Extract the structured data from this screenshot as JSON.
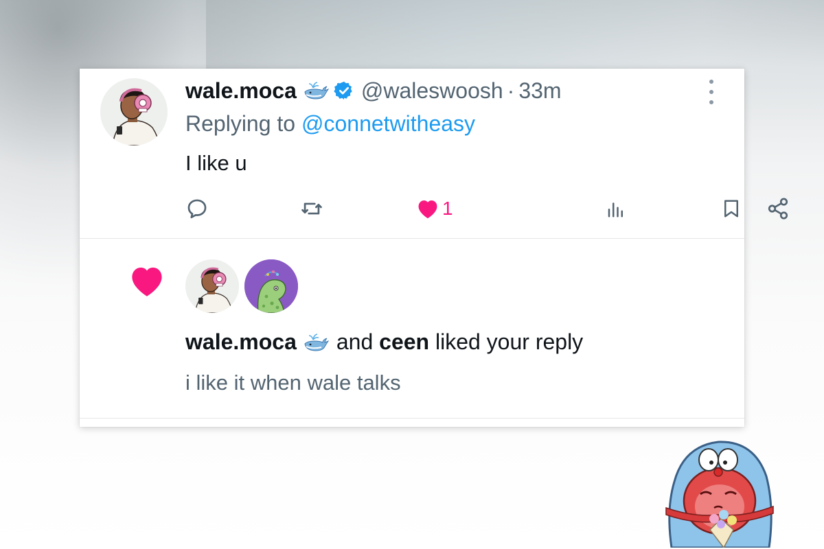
{
  "tweet": {
    "display_name": "wale.moca",
    "name_emoji": "whale-emoji",
    "verified": true,
    "handle": "@waleswoosh",
    "separator": "·",
    "time": "33m",
    "replying_prefix": "Replying to",
    "replying_to": "@connetwitheasy",
    "text": "I like u",
    "like_count": "1",
    "liked": true
  },
  "notification": {
    "user1": "wale.moca",
    "user1_emoji": "whale-emoji",
    "connector": "and",
    "user2": "ceen",
    "action_text": "liked your reply",
    "reply_text": "i like it when wale talks"
  },
  "colors": {
    "like_pink": "#f91880",
    "link_blue": "#1d9bf0",
    "muted_gray": "#536471",
    "text_dark": "#0f1419"
  }
}
